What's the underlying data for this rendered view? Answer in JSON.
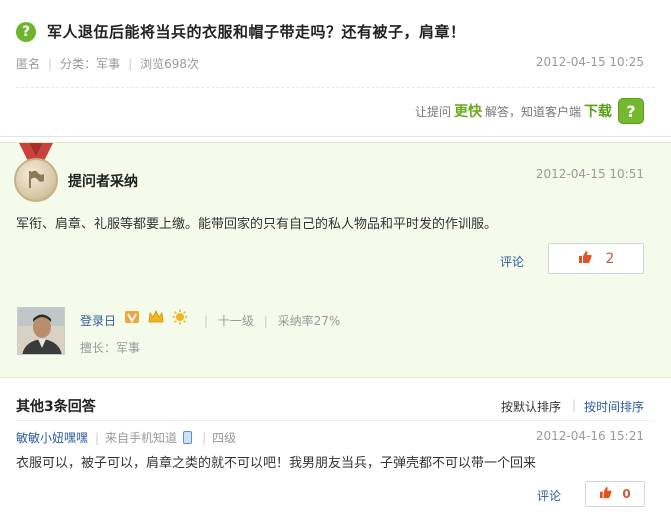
{
  "question": {
    "icon": "question-icon",
    "icon_glyph": "?",
    "title": "军人退伍后能将当兵的衣服和帽子带走吗？还有被子，肩章！",
    "author": "匿名",
    "category": "分类：军事",
    "views": "浏览698次",
    "time": "2012-04-15 10:25"
  },
  "promo": {
    "text1": "让提问",
    "highlight": "更快",
    "text2": "解答，知道客户端",
    "download": "下载",
    "icon": "question-app-icon",
    "icon_glyph": "?"
  },
  "accepted": {
    "label": "提问者采纳",
    "medal_icon": "medal-icon",
    "time": "2012-04-15 10:51",
    "content": "军衔、肩章、礼服等都要上缴。能带回家的只有自己的私人物品和平时发的作训服。",
    "comment_label": "评论",
    "like_icon": "thumb-up-icon",
    "likes": "2",
    "user": {
      "name": "登录日",
      "level": "十一级",
      "adoption_rate": "采纳率27%",
      "specialty": "擅长：军事",
      "badges": [
        "v-badge-icon",
        "crown-icon",
        "sun-icon"
      ]
    }
  },
  "others": {
    "heading": "其他3条回答",
    "sort_default": "按默认排序",
    "sort_time": "按时间排序",
    "answers": [
      {
        "user": "敏敏小妞嘿嘿",
        "source": "来自手机知道",
        "source_icon": "phone-icon",
        "level": "四级",
        "time": "2012-04-16 15:21",
        "content": "衣服可以，被子可以，肩章之类的就不可以吧！我男朋友当兵，子弹壳都不可以带一个回来",
        "comment_label": "评论",
        "likes": "0"
      }
    ]
  },
  "colors": {
    "accent_green": "#6fb52c",
    "link_blue": "#2e5b9c",
    "accepted_bg": "#f4fbea",
    "like_red": "#e0521f"
  }
}
